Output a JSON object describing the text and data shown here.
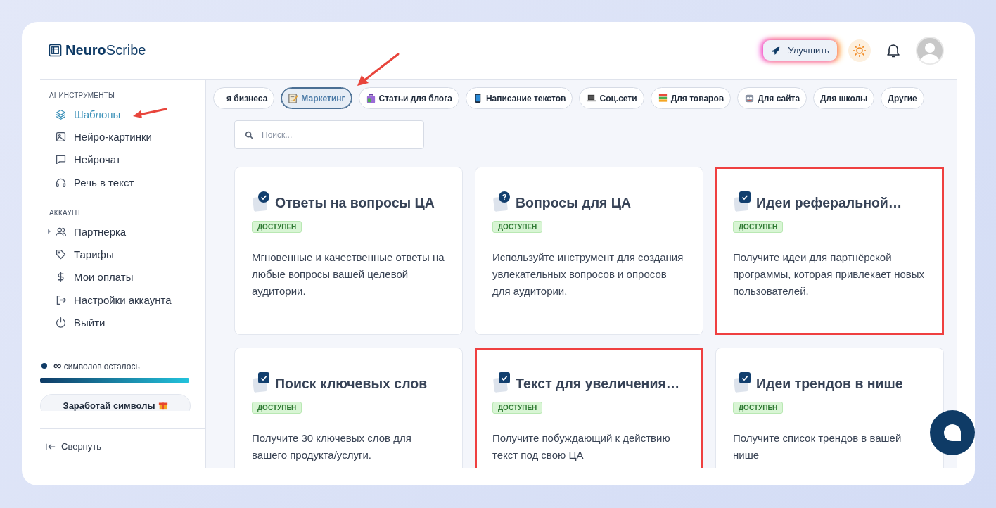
{
  "logo": {
    "bold": "Neuro",
    "rest": "Scribe"
  },
  "header": {
    "upgrade_button": "Улучшить"
  },
  "sidebar": {
    "sections": [
      {
        "title": "AI-ИНСТРУМЕНТЫ",
        "items": [
          {
            "label": "Шаблоны",
            "selected": true,
            "expandable": false
          },
          {
            "label": "Нейро-картинки",
            "selected": false,
            "expandable": false
          },
          {
            "label": "Нейрочат",
            "selected": false,
            "expandable": false
          },
          {
            "label": "Речь в текст",
            "selected": false,
            "expandable": false
          }
        ]
      },
      {
        "title": "АККАУНТ",
        "items": [
          {
            "label": "Партнерка",
            "selected": false,
            "expandable": true
          },
          {
            "label": "Тарифы",
            "selected": false,
            "expandable": false
          },
          {
            "label": "Мои оплаты",
            "selected": false,
            "expandable": false
          },
          {
            "label": "Настройки аккаунта",
            "selected": false,
            "expandable": false
          },
          {
            "label": "Выйти",
            "selected": false,
            "expandable": false
          }
        ]
      }
    ],
    "quota": {
      "amount": "∞",
      "label": "символов осталось",
      "level": 1
    },
    "earn_button": "Заработай символы",
    "collapse": "Свернуть"
  },
  "categories": [
    {
      "label": "я бизнеса",
      "selected": false
    },
    {
      "label": "Маркетинг",
      "selected": true
    },
    {
      "label": "Статьи для блога",
      "selected": false
    },
    {
      "label": "Написание текстов",
      "selected": false
    },
    {
      "label": "Соц.сети",
      "selected": false
    },
    {
      "label": "Для товаров",
      "selected": false
    },
    {
      "label": "Для сайта",
      "selected": false
    },
    {
      "label": "Для школы",
      "selected": false
    },
    {
      "label": "Другие",
      "selected": false
    }
  ],
  "search": {
    "placeholder": "Поиск..."
  },
  "cards": [
    {
      "title": "Ответы на вопросы ЦА",
      "kind": "check",
      "badge": "ДОСТУПЕН",
      "description": "Мгновенные и качественные ответы на любые вопросы вашей целевой аудитории.",
      "highlighted": false
    },
    {
      "title": "Вопросы для ЦА",
      "kind": "question",
      "icon_text": "?",
      "badge": "ДОСТУПЕН",
      "description": "Используйте инструмент для создания увлекательных вопросов и опросов для аудитории.",
      "highlighted": false
    },
    {
      "title": "Идеи реферальной…",
      "kind": "checkbox",
      "badge": "ДОСТУПЕН",
      "description": "Получите идеи для партнёрской программы, которая привлекает новых пользователей.",
      "highlighted": true
    },
    {
      "title": "Поиск ключевых слов",
      "kind": "checkbox",
      "badge": "ДОСТУПЕН",
      "description": "Получите 30 ключевых слов для вашего продукта/услуги.",
      "highlighted": false
    },
    {
      "title": "Текст для увеличения…",
      "kind": "checkbox",
      "badge": "ДОСТУПЕН",
      "description": "Получите побуждающий к действию текст под свою ЦА",
      "highlighted": true
    },
    {
      "title": "Идеи трендов в нише",
      "kind": "checkbox",
      "badge": "ДОСТУПЕН",
      "description": "Получите список трендов в вашей нише",
      "highlighted": false
    }
  ]
}
